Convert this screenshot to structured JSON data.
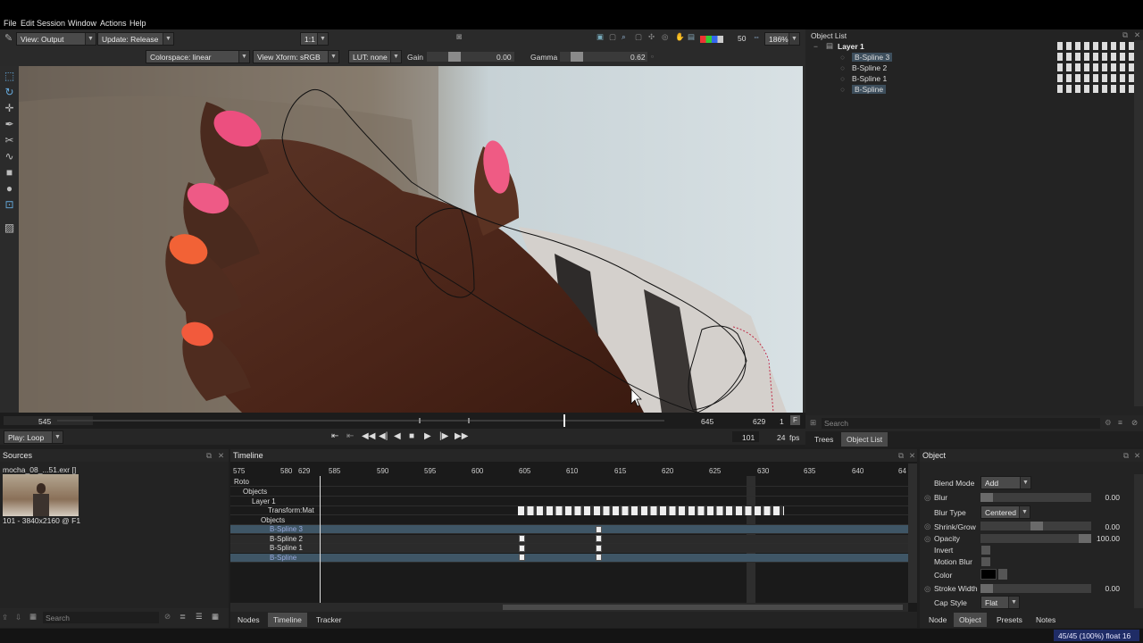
{
  "menu": {
    "items": [
      "File",
      "Edit",
      "Session",
      "Window",
      "Actions",
      "Help"
    ]
  },
  "toolbar": {
    "view_output": "View: Output",
    "update": "Update: Release",
    "zoom_ratio": "1:1",
    "frame_value": "50",
    "zoom_percent": "186%",
    "colorspace": "Colorspace: linear",
    "view_xform": "View Xform: sRGB",
    "lut": "LUT: none",
    "gain_label": "Gain",
    "gain_value": "0.00",
    "gamma_label": "Gamma",
    "gamma_value": "0.62"
  },
  "scrubber": {
    "start": "545",
    "current": "645",
    "end": "629",
    "step": "1",
    "flag": "F"
  },
  "playback": {
    "mode": "Play: Loop",
    "frame": "101",
    "fps_value": "24",
    "fps_unit": "fps"
  },
  "object_list": {
    "title": "Object List",
    "layer": "Layer 1",
    "items": [
      "B-Spline 3",
      "B-Spline 2",
      "B-Spline 1",
      "B-Spline"
    ],
    "search_placeholder": "Search",
    "tabs": [
      "Trees",
      "Object List"
    ]
  },
  "sources": {
    "title": "Sources",
    "clip_name": "mocha_08_...51.exr []",
    "clip_info": "101 - 3840x2160 @ F1",
    "search_placeholder": "Search"
  },
  "timeline": {
    "title": "Timeline",
    "ticks": [
      "575",
      "580",
      "629",
      "585",
      "590",
      "595",
      "600",
      "605",
      "610",
      "615",
      "620",
      "625",
      "630",
      "635",
      "640",
      "64"
    ],
    "rows": [
      "Roto",
      "Objects",
      "Layer 1",
      "Transform:Mat",
      "Objects",
      "B-Spline 3",
      "B-Spline 2",
      "B-Spline 1",
      "B-Spline"
    ],
    "tabs": [
      "Nodes",
      "Timeline",
      "Tracker"
    ]
  },
  "object_panel": {
    "title": "Object",
    "blend_mode_label": "Blend Mode",
    "blend_mode": "Add",
    "blur_label": "Blur",
    "blur_value": "0.00",
    "blur_type_label": "Blur Type",
    "blur_type": "Centered",
    "shrink_label": "Shrink/Grow",
    "shrink_value": "0.00",
    "opacity_label": "Opacity",
    "opacity_value": "100.00",
    "invert_label": "Invert",
    "motion_blur_label": "Motion Blur",
    "color_label": "Color",
    "stroke_width_label": "Stroke Width",
    "stroke_width_value": "0.00",
    "cap_style_label": "Cap Style",
    "cap_style": "Flat",
    "tabs": [
      "Node",
      "Object",
      "Presets",
      "Notes"
    ]
  },
  "status": {
    "text": "45/45 (100%) float 16"
  },
  "colors": {
    "accent": "#3f5666",
    "spline": "#111111",
    "selected_spline": "#c0304a"
  }
}
